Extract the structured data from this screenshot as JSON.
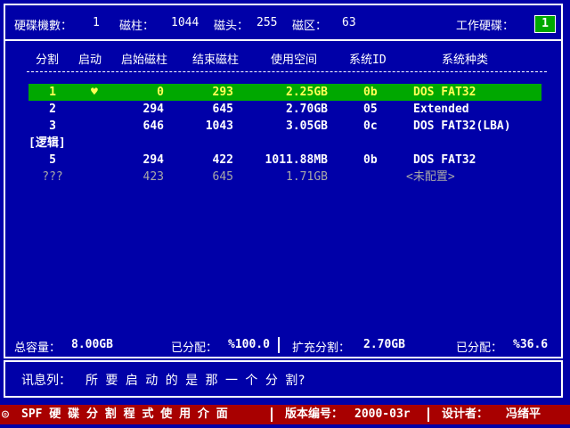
{
  "top_bar": {
    "disk_count_label": "硬碟機數：",
    "disk_count": "1",
    "cylinders_label": "磁柱：",
    "cylinders": "1044",
    "heads_label": "磁头：",
    "heads": "255",
    "sectors_label": "磁区：",
    "sectors": "63",
    "working_disk_label": "工作硬碟：",
    "working_disk": "1"
  },
  "table": {
    "headers": {
      "partition": "分割",
      "boot": "启动",
      "start_cyl": "启始磁柱",
      "end_cyl": "结束磁柱",
      "space": "使用空间",
      "sys_id": "系统ID",
      "sys_type": "系统种类"
    },
    "rows": [
      {
        "partition": "1",
        "boot": "♥",
        "start": "0",
        "end": "293",
        "space": "2.25GB",
        "sys_id": "0b",
        "sys_type": "DOS FAT32",
        "state": "selected"
      },
      {
        "partition": "2",
        "boot": "",
        "start": "294",
        "end": "645",
        "space": "2.70GB",
        "sys_id": "05",
        "sys_type": "Extended",
        "state": "normal"
      },
      {
        "partition": "3",
        "boot": "",
        "start": "646",
        "end": "1043",
        "space": "3.05GB",
        "sys_id": "0c",
        "sys_type": "DOS FAT32(LBA)",
        "state": "normal"
      },
      {
        "partition": "5",
        "boot": "",
        "start": "294",
        "end": "422",
        "space": "1011.88MB",
        "sys_id": "0b",
        "sys_type": "DOS FAT32",
        "state": "normal"
      },
      {
        "partition": "???",
        "boot": "",
        "start": "423",
        "end": "645",
        "space": "1.71GB",
        "sys_id": "",
        "sys_type": "<未配置>",
        "state": "unalloc"
      }
    ],
    "logical_label": "[逻辑]"
  },
  "summary": {
    "total_label": "总容量：",
    "total": "8.00GB",
    "allocated_label": "已分配：",
    "allocated": "%100.0",
    "extended_label": "扩充分割：",
    "extended": "2.70GB",
    "ext_allocated_label": "已分配：",
    "ext_allocated": "%36.6"
  },
  "message": {
    "label": "讯息列：",
    "text": "所 要 启 动 的 是 那 一 个 分 割?"
  },
  "status_bar": {
    "icon": "target-icon",
    "title": "SPF 硬 碟 分 割 程 式 使 用 介 面",
    "version_label": "版本编号：",
    "version": "2000-03r",
    "designer_label": "设计者：",
    "designer": "冯绪平"
  },
  "colors": {
    "background": "#0000a8",
    "selection": "#00a800",
    "selected_text": "#ffff55",
    "unallocated_text": "#a8a8a8",
    "status_bar": "#a80000"
  }
}
